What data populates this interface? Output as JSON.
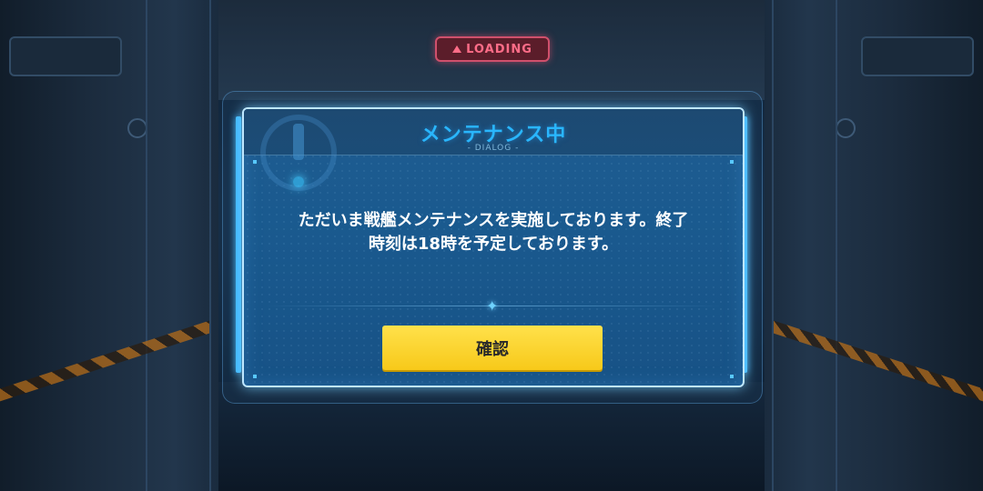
{
  "background": {
    "sign_text": "LOADING",
    "accent_color": "#ff6d88"
  },
  "dialog": {
    "title": "メンテナンス中",
    "subtitle": "- DIALOG -",
    "message_line1": "ただいま戦艦メンテナンスを実施しております。終了",
    "message_line2": "時刻は18時を予定しております。",
    "confirm_label": "確認",
    "title_color": "#29b6ff",
    "button_color": "#f7c91a",
    "icon": "warning-exclamation-icon",
    "divider_icon": "sparkle-icon"
  }
}
